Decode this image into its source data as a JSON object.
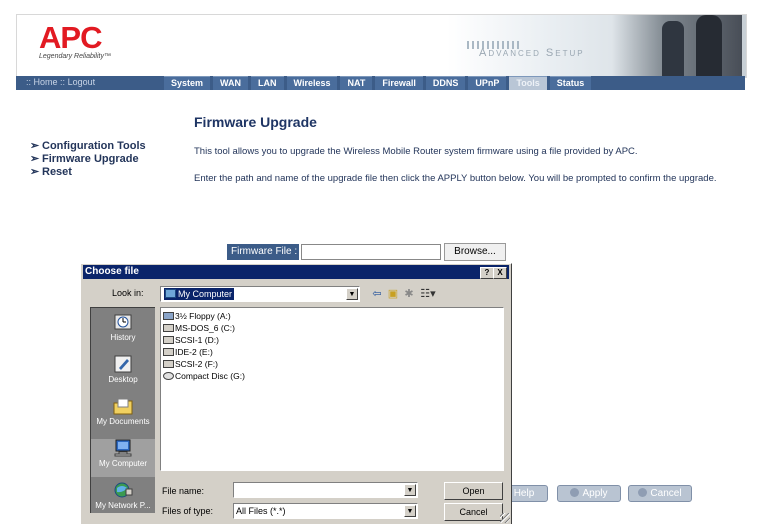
{
  "brand": {
    "logo": "APC",
    "tagline": "Legendary Reliability™",
    "banner_text": "Advanced Setup"
  },
  "nav": {
    "left": [
      "Home",
      "Logout"
    ],
    "tabs": [
      "System",
      "WAN",
      "LAN",
      "Wireless",
      "NAT",
      "Firewall",
      "DDNS",
      "UPnP",
      "Tools",
      "Status"
    ],
    "active_tab": "Tools"
  },
  "menu": [
    "Configuration Tools",
    "Firmware Upgrade",
    "Reset"
  ],
  "content": {
    "title": "Firmware Upgrade",
    "para1": "This tool allows you to upgrade the Wireless Mobile Router system firmware using a file provided by APC.",
    "para2": "Enter the path and name of the upgrade file then click the APPLY button below. You will be prompted to confirm the upgrade.",
    "firmware_label": "Firmware File :",
    "firmware_value": "",
    "browse_label": "Browse...",
    "help_label": "Help",
    "apply_label": "Apply",
    "cancel_label": "Cancel"
  },
  "dialog": {
    "title": "Choose file",
    "help_btn": "?",
    "close_btn": "X",
    "lookin_label": "Look in:",
    "lookin_value": "My Computer",
    "places": [
      "History",
      "Desktop",
      "My Documents",
      "My Computer",
      "My Network P..."
    ],
    "selected_place": "My Computer",
    "files": [
      "3½ Floppy (A:)",
      "MS-DOS_6 (C:)",
      "SCSI-1 (D:)",
      "IDE-2 (E:)",
      "SCSI-2 (F:)",
      "Compact Disc (G:)"
    ],
    "filename_label": "File name:",
    "filename_value": "",
    "filetype_label": "Files of type:",
    "filetype_value": "All Files (*.*)",
    "open_label": "Open",
    "cancel_label": "Cancel"
  },
  "colors": {
    "nav": "#3c5c88",
    "title_blue": "#1f3564",
    "dialog_title": "#0a246a",
    "logo_red": "#e21a22"
  }
}
